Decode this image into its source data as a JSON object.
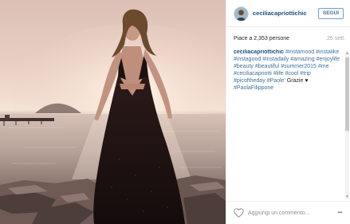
{
  "post": {
    "username": "ceciliacapriottichic",
    "follow_label": "SEGUI",
    "likes_text": "Piace a 2,353 persone",
    "time_text": "26 sett.",
    "caption": {
      "author": "ceciliacapriottichic",
      "segments": [
        {
          "text": "#instamood",
          "hashtag": true
        },
        {
          "text": "#instalike",
          "hashtag": true
        },
        {
          "text": "#instagood",
          "hashtag": true
        },
        {
          "text": "#instadaily",
          "hashtag": true
        },
        {
          "text": "#amazing",
          "hashtag": true
        },
        {
          "text": "#enjoylife",
          "hashtag": true
        },
        {
          "text": "#beauty",
          "hashtag": true
        },
        {
          "text": "#beautiful",
          "hashtag": true
        },
        {
          "text": "#summer2015",
          "hashtag": true
        },
        {
          "text": "#me",
          "hashtag": true
        },
        {
          "text": "#ceciliacapriotti",
          "hashtag": true
        },
        {
          "text": "#life",
          "hashtag": true
        },
        {
          "text": "#cool",
          "hashtag": true
        },
        {
          "text": "#trip",
          "hashtag": true
        },
        {
          "text": "#picoftheday",
          "hashtag": true
        },
        {
          "text": "#Paole'",
          "hashtag": true
        },
        {
          "text": "Grazie",
          "hashtag": false
        },
        {
          "text": "♥",
          "hashtag": false
        },
        {
          "text": "#PaolaFilippone",
          "hashtag": true
        }
      ]
    },
    "comment_placeholder": "Aggiungi un commento...",
    "more_label": "•••"
  },
  "icons": {
    "avatar": "profile-avatar-icon",
    "like": "heart-outline-icon",
    "more": "more-options-icon"
  },
  "colors": {
    "username": "#1e4e79",
    "hashtag": "#3f729b",
    "follow_border": "#6d9ed6",
    "muted": "#a5a5a5"
  }
}
